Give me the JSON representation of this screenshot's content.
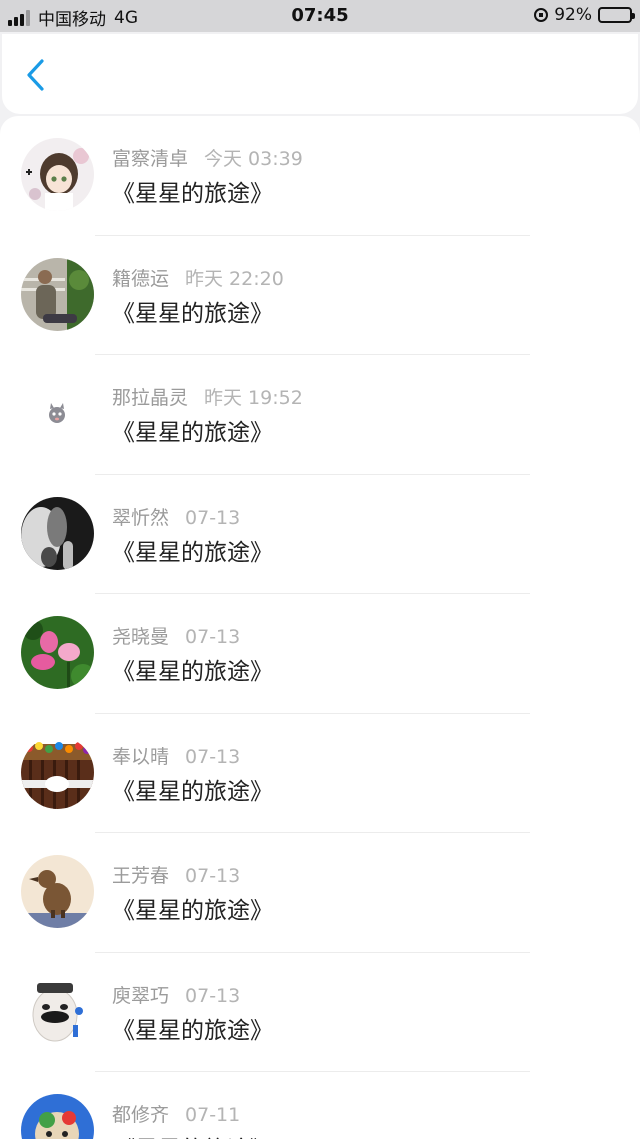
{
  "status_bar": {
    "carrier": "中国移动",
    "network": "4G",
    "time": "07:45",
    "battery_percent": "92%",
    "battery_level": 0.92
  },
  "header": {
    "back_icon": "chevron-left-icon",
    "accent": "#1a9be6"
  },
  "items": [
    {
      "name": "富察清卓",
      "time": "今天 03:39",
      "title": "《星星的旅途》"
    },
    {
      "name": "籍德运",
      "time": "昨天 22:20",
      "title": "《星星的旅途》"
    },
    {
      "name": "那拉晶灵",
      "time": "昨天 19:52",
      "title": "《星星的旅途》"
    },
    {
      "name": "翠忻然",
      "time": "07-13",
      "title": "《星星的旅途》"
    },
    {
      "name": "尧晓曼",
      "time": "07-13",
      "title": "《星星的旅途》"
    },
    {
      "name": "奉以晴",
      "time": "07-13",
      "title": "《星星的旅途》"
    },
    {
      "name": "王芳春",
      "time": "07-13",
      "title": "《星星的旅途》"
    },
    {
      "name": "庾翠巧",
      "time": "07-13",
      "title": "《星星的旅途》"
    },
    {
      "name": "都修齐",
      "time": "07-11",
      "title": "《星星的旅途》"
    }
  ]
}
